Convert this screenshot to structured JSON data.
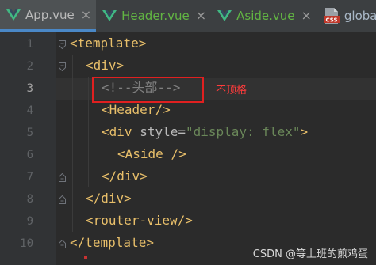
{
  "tabs": [
    {
      "label": "App.vue",
      "icon": "vue-icon",
      "active": true
    },
    {
      "label": "Header.vue",
      "icon": "vue-icon",
      "active": false
    },
    {
      "label": "Aside.vue",
      "icon": "vue-icon",
      "active": false
    },
    {
      "label": "global.c",
      "icon": "css-file-icon",
      "active": false,
      "icon_text": "CSS"
    }
  ],
  "tab_close_glyph": "×",
  "editor": {
    "line_numbers": [
      "1",
      "2",
      "3",
      "4",
      "5",
      "6",
      "7",
      "8",
      "9",
      "10"
    ],
    "current_line": "3",
    "lines": [
      {
        "open": "<",
        "tag": "template",
        "close": ">"
      },
      {
        "open": "<",
        "tag": "div",
        "close": ">"
      },
      {
        "comment": "<!--头部-->"
      },
      {
        "open": "<",
        "tag": "Header",
        "close": "/>"
      },
      {
        "open": "<",
        "tag": "div",
        "attr_name": "style",
        "eq": "=",
        "attr_value": "\"display: flex\"",
        "close": ">"
      },
      {
        "open": "<",
        "tag": "Aside",
        "close": " />"
      },
      {
        "open": "</",
        "tag": "div",
        "close": ">"
      },
      {
        "open": "</",
        "tag": "div",
        "close": ">"
      },
      {
        "open": "<",
        "tag": "router-view",
        "close": "/>"
      },
      {
        "open": "</",
        "tag": "template",
        "close": ">"
      }
    ]
  },
  "annotation": {
    "text": "不顶格",
    "color": "#ff3b3b"
  },
  "watermark": "CSDN @等上班的煎鸡蛋",
  "colors": {
    "background": "#2b2b2b",
    "gutter": "#313335",
    "tag": "#e8bf6a",
    "attr": "#bababa",
    "string": "#6a8759",
    "comment": "#808080",
    "vue_green": "#41b883",
    "active_tab_underline": "#4a88c7"
  }
}
